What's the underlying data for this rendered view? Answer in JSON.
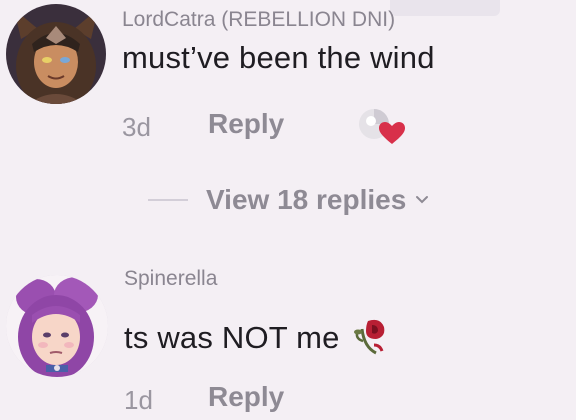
{
  "comments": [
    {
      "username": "LordCatra (REBELLION DNI)",
      "text": "must’ve been the wind",
      "time": "3d",
      "reply_label": "Reply",
      "avatar_icon": "catra-avatar-icon",
      "reaction_icon": "heart-reaction-icon"
    },
    {
      "username": "Spinerella",
      "text": "ts was NOT me",
      "emoji_icon": "wilted-rose-icon",
      "time": "1d",
      "reply_label": "Reply",
      "avatar_icon": "spinnerella-avatar-icon"
    }
  ],
  "view_replies": {
    "label": "View 18 replies",
    "icon": "chevron-down-icon"
  },
  "colors": {
    "background": "#f4eff4",
    "username": "#8a8590",
    "text": "#1f1d22",
    "muted": "#8e8a94",
    "heart": "#d8304a"
  }
}
